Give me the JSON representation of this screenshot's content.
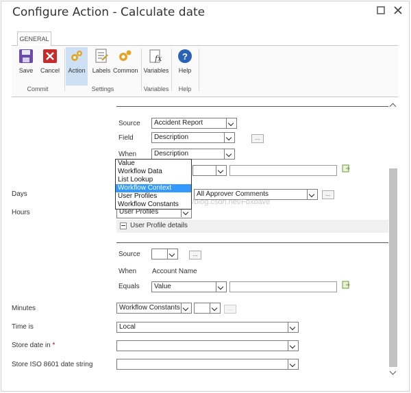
{
  "dialog": {
    "title": "Configure Action - Calculate date",
    "maximize_icon": "maximize-icon",
    "close_icon": "close-icon"
  },
  "ribbon": {
    "tab": "GENERAL",
    "commit": {
      "label": "Commit",
      "save": "Save",
      "cancel": "Cancel"
    },
    "settings": {
      "label": "Settings",
      "action": "Action",
      "labels": "Labels",
      "common": "Common"
    },
    "variables": {
      "label": "Variables",
      "variables": "Variables"
    },
    "help": {
      "label": "Help",
      "help": "Help"
    }
  },
  "lookup1": {
    "source_label": "Source",
    "source_value": "Accident Report",
    "field_label": "Field",
    "field_value": "Description",
    "field_btn": "...",
    "when_label": "When",
    "when_value": "Description",
    "dropdown_options": [
      "Value",
      "Workflow Data",
      "List Lookup",
      "Workflow Context",
      "User Profiles",
      "Workflow Constants"
    ],
    "selected_option": "Workflow Context",
    "second_value": "All Approver Comments",
    "second_btn": "...",
    "third_value": "User Profiles",
    "profile_details": "User Profile details"
  },
  "lookup2": {
    "source_label": "Source",
    "source_btn": "...",
    "when_label": "When",
    "when_value": "Account Name",
    "equals_label": "Equals",
    "equals_value": "Value"
  },
  "fields": {
    "days": "Days",
    "hours": "Hours",
    "minutes": "Minutes",
    "minutes_value": "Workflow Constants",
    "minutes_btn": "...",
    "time_is": "Time is",
    "time_is_value": "Local",
    "store_date": "Store date in",
    "required_mark": "*",
    "store_iso": "Store ISO 8601 date string"
  },
  "watermark": "http://blog.csdn.net/Foxbave",
  "colors": {
    "accent": "#3399ff",
    "required": "#c00000",
    "icon_blue": "#2a62b5",
    "cancel_red": "#c62b2b"
  }
}
